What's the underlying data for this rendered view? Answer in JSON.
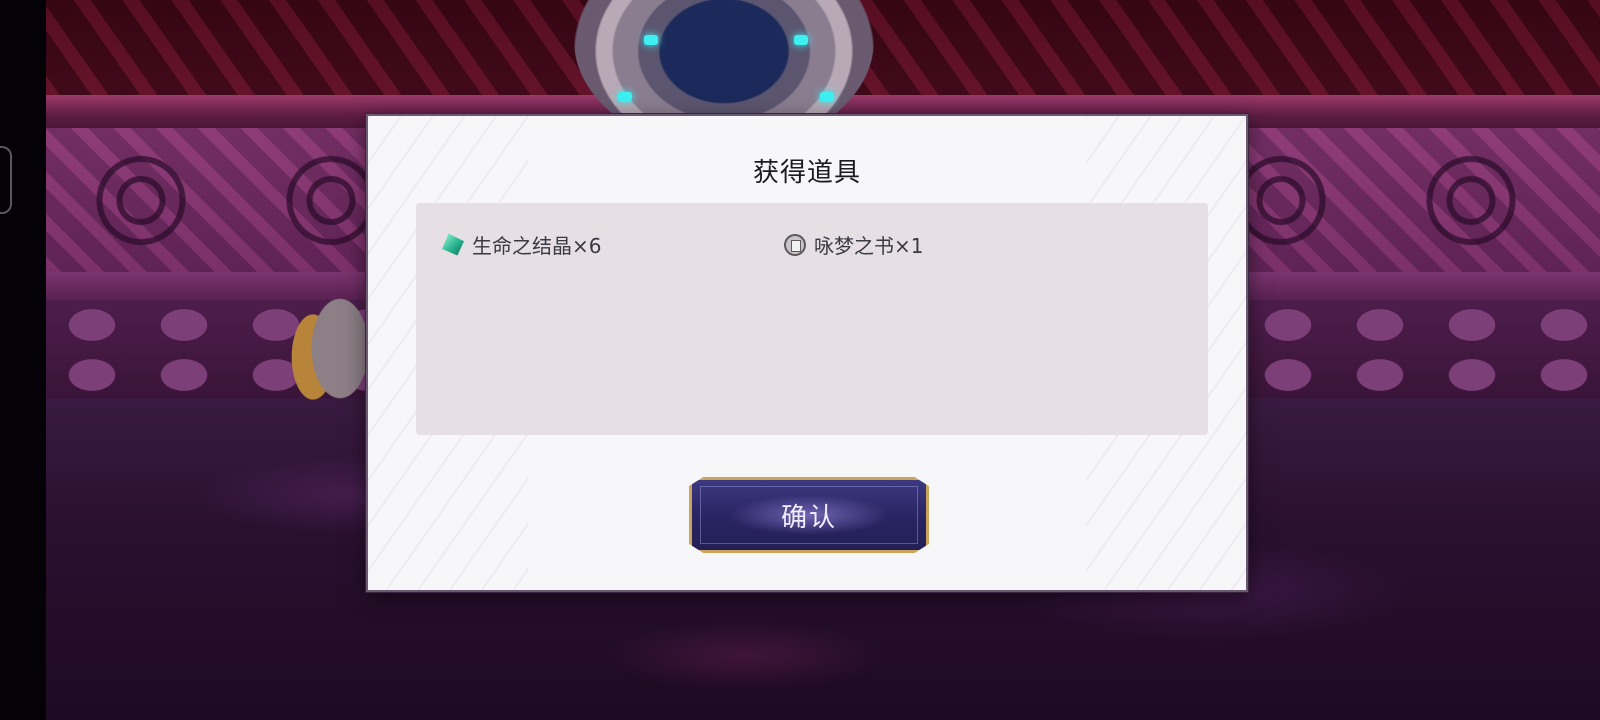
{
  "dialog": {
    "title": "获得道具",
    "items": [
      {
        "icon": "life-crystal-icon",
        "label": "生命之结晶×6"
      },
      {
        "icon": "dream-book-icon",
        "label": "咏梦之书×1"
      }
    ],
    "confirm_label": "确认"
  },
  "colors": {
    "dialog_bg": "#f7f6f9",
    "panel_bg": "#e6dfe4",
    "button_bg": "#2a2563",
    "button_border": "#c9a45a"
  }
}
